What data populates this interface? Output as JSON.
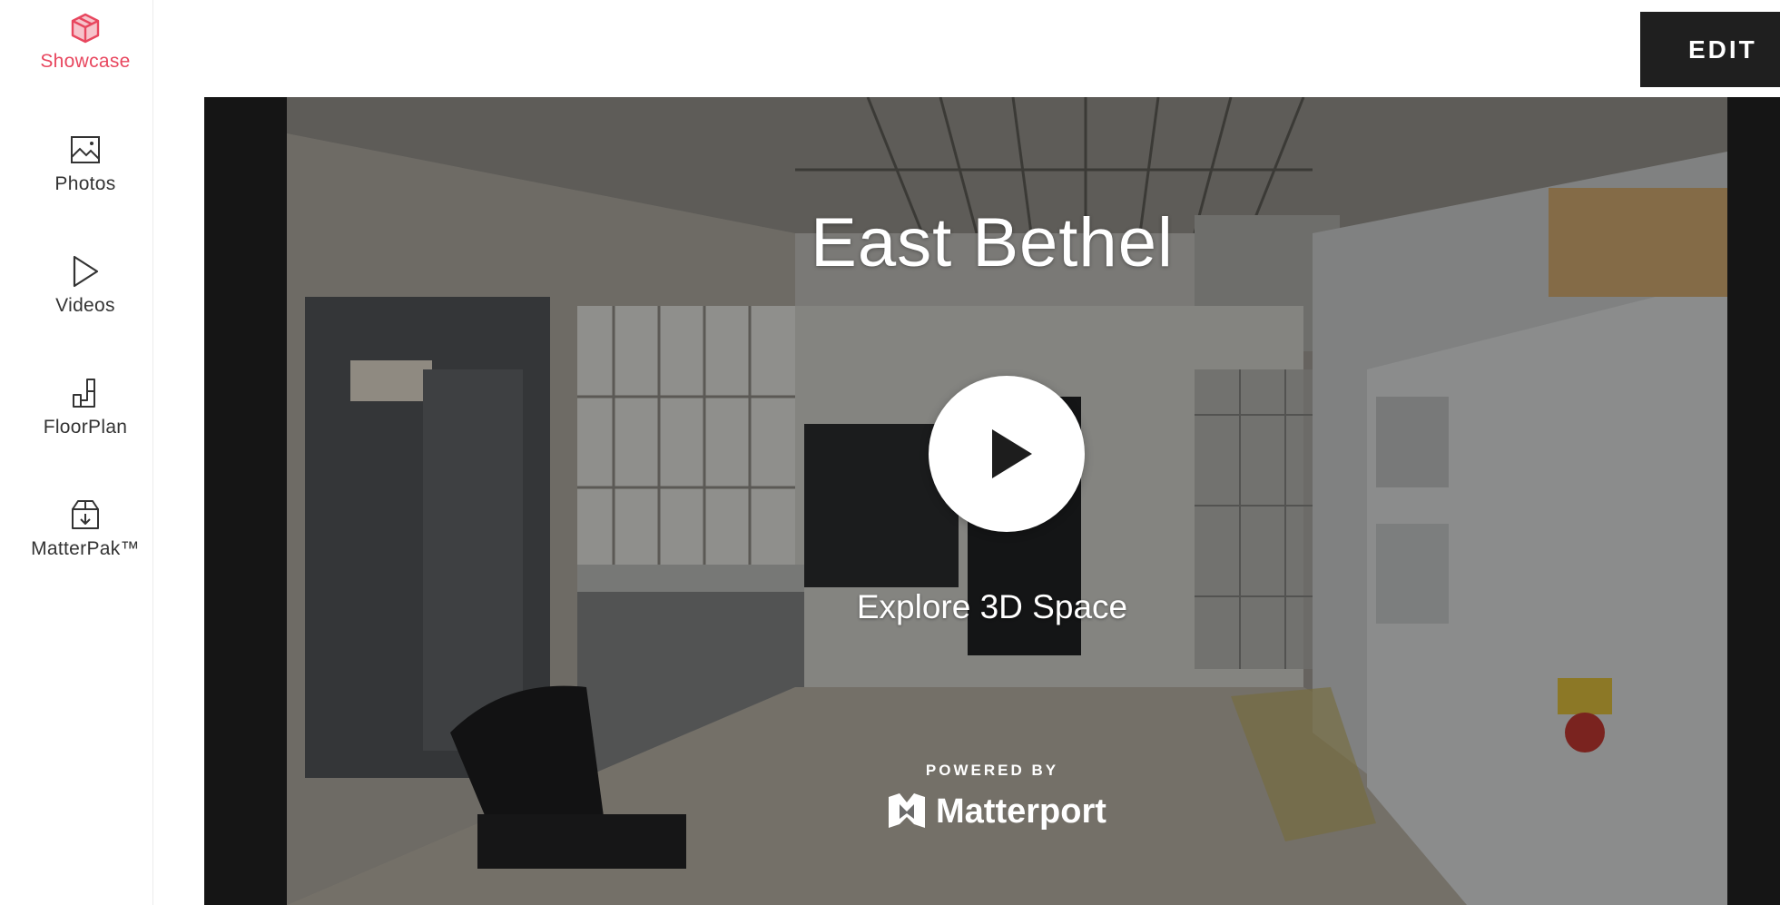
{
  "sidebar": {
    "items": [
      {
        "label": "Showcase",
        "icon": "cube-icon",
        "active": true
      },
      {
        "label": "Photos",
        "icon": "image-icon",
        "active": false
      },
      {
        "label": "Videos",
        "icon": "play-outline-icon",
        "active": false
      },
      {
        "label": "FloorPlan",
        "icon": "floorplan-icon",
        "active": false
      },
      {
        "label": "MatterPak™",
        "icon": "package-download-icon",
        "active": false
      }
    ],
    "active_color": "#e8475f"
  },
  "header": {
    "edit_label": "EDIT"
  },
  "viewer": {
    "title": "East Bethel",
    "cta_label": "Explore 3D Space",
    "powered_by": "POWERED BY",
    "brand": "Matterport",
    "play_icon": "play-icon"
  }
}
